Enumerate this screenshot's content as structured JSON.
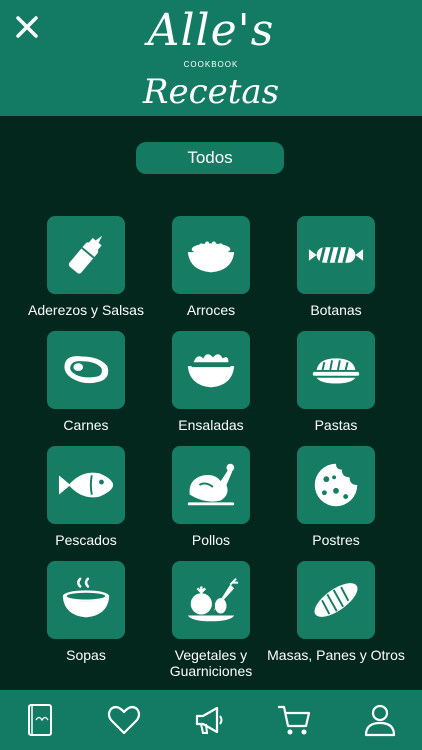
{
  "header": {
    "logo_text": "Alle's",
    "logo_sub": "COOKBOOK",
    "title": "Recetas"
  },
  "filter": {
    "label": "Todos"
  },
  "categories": [
    {
      "label": "Aderezos y Salsas",
      "icon": "sauce-bottle-icon"
    },
    {
      "label": "Arroces",
      "icon": "rice-bowl-icon"
    },
    {
      "label": "Botanas",
      "icon": "candy-icon"
    },
    {
      "label": "Carnes",
      "icon": "steak-icon"
    },
    {
      "label": "Ensaladas",
      "icon": "salad-bowl-icon"
    },
    {
      "label": "Pastas",
      "icon": "pasta-plate-icon"
    },
    {
      "label": "Pescados",
      "icon": "fish-icon"
    },
    {
      "label": "Pollos",
      "icon": "roast-chicken-icon"
    },
    {
      "label": "Postres",
      "icon": "cookie-icon"
    },
    {
      "label": "Sopas",
      "icon": "soup-bowl-icon"
    },
    {
      "label": "Vegetales y Guarniciones",
      "icon": "vegetables-icon"
    },
    {
      "label": "Masas, Panes y Otros",
      "icon": "bread-icon"
    }
  ],
  "bottom_nav": [
    "cookbook-icon",
    "heart-icon",
    "megaphone-icon",
    "cart-icon",
    "user-icon"
  ],
  "colors": {
    "header": "#137a63",
    "background": "#03271c",
    "tile": "#167c63"
  }
}
